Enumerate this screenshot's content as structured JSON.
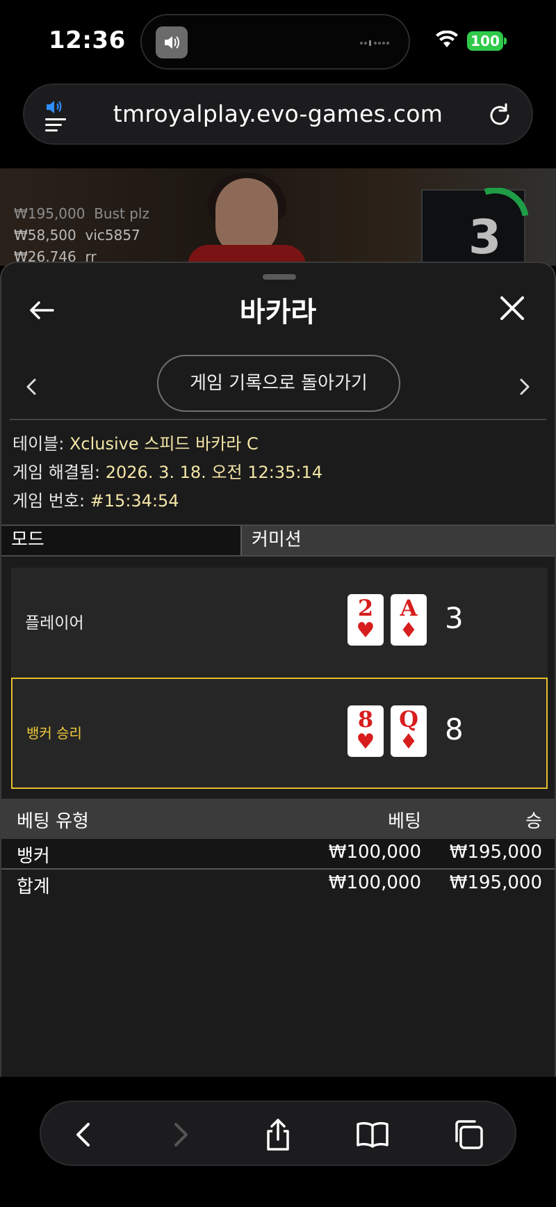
{
  "status": {
    "time": "12:36",
    "battery": "100"
  },
  "browser": {
    "url": "tmroyalplay.evo-games.com"
  },
  "video": {
    "bets": [
      {
        "amount": "₩195,000",
        "name": "Bust plz"
      },
      {
        "amount": "₩58,500",
        "name": "vic5857"
      },
      {
        "amount": "₩26,746",
        "name": "rr"
      }
    ],
    "timer": "3"
  },
  "panel": {
    "title": "바카라",
    "history_button": "게임 기록으로 돌아가기",
    "info": {
      "table_label": "테이블: ",
      "table_value": "Xclusive 스피드 바카라 C",
      "resolved_label": "게임 해결됨: ",
      "resolved_value": "2026. 3. 18. 오전 12:35:14",
      "number_label": "게임 번호: ",
      "number_value": "#15:34:54"
    },
    "tabs": {
      "mode": "모드",
      "commission": "커미션"
    },
    "player": {
      "label": "플레이어",
      "cards": [
        {
          "rank": "2",
          "suit": "♥"
        },
        {
          "rank": "A",
          "suit": "♦"
        }
      ],
      "score": "3"
    },
    "banker": {
      "label": "뱅커 승리",
      "cards": [
        {
          "rank": "8",
          "suit": "♥"
        },
        {
          "rank": "Q",
          "suit": "♦"
        }
      ],
      "score": "8"
    },
    "bets_table": {
      "headers": {
        "type": "베팅 유형",
        "bet": "베팅",
        "win": "승"
      },
      "rows": [
        {
          "type": "뱅커",
          "bet": "₩100,000",
          "win": "₩195,000"
        }
      ],
      "total": {
        "type": "합계",
        "bet": "₩100,000",
        "win": "₩195,000"
      }
    }
  },
  "colors": {
    "accent_gold": "#e6c02a",
    "value_text": "#f4e6a7",
    "card_red": "#d71d1d",
    "battery": "#30c94a"
  }
}
